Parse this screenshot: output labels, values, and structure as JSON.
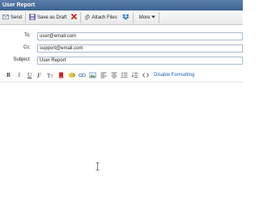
{
  "window": {
    "title": "User Report"
  },
  "toolbar": {
    "send_label": "Send",
    "save_draft_label": "Save as Draft",
    "attach_label": "Attach Files",
    "more_label": "More"
  },
  "fields": {
    "to_label": "To:",
    "to_value": "user@email.com",
    "cc_label": "Cc:",
    "cc_value": "support@email.com",
    "subject_label": "Subject:",
    "subject_value": "User Report"
  },
  "format_bar": {
    "bold": "B",
    "italic": "I",
    "underline": "U",
    "strike": "S",
    "disable_formatting_label": "Disable Formatting"
  },
  "icons": [
    "send-icon",
    "floppy-disk-icon",
    "discard-x-icon",
    "paperclip-icon",
    "dropbox-icon",
    "chevron-down-icon"
  ],
  "colors": {
    "titlebar": "#3d6493",
    "link": "#1e63b8",
    "discard": "#d0201c",
    "dropbox": "#1a73c8"
  }
}
